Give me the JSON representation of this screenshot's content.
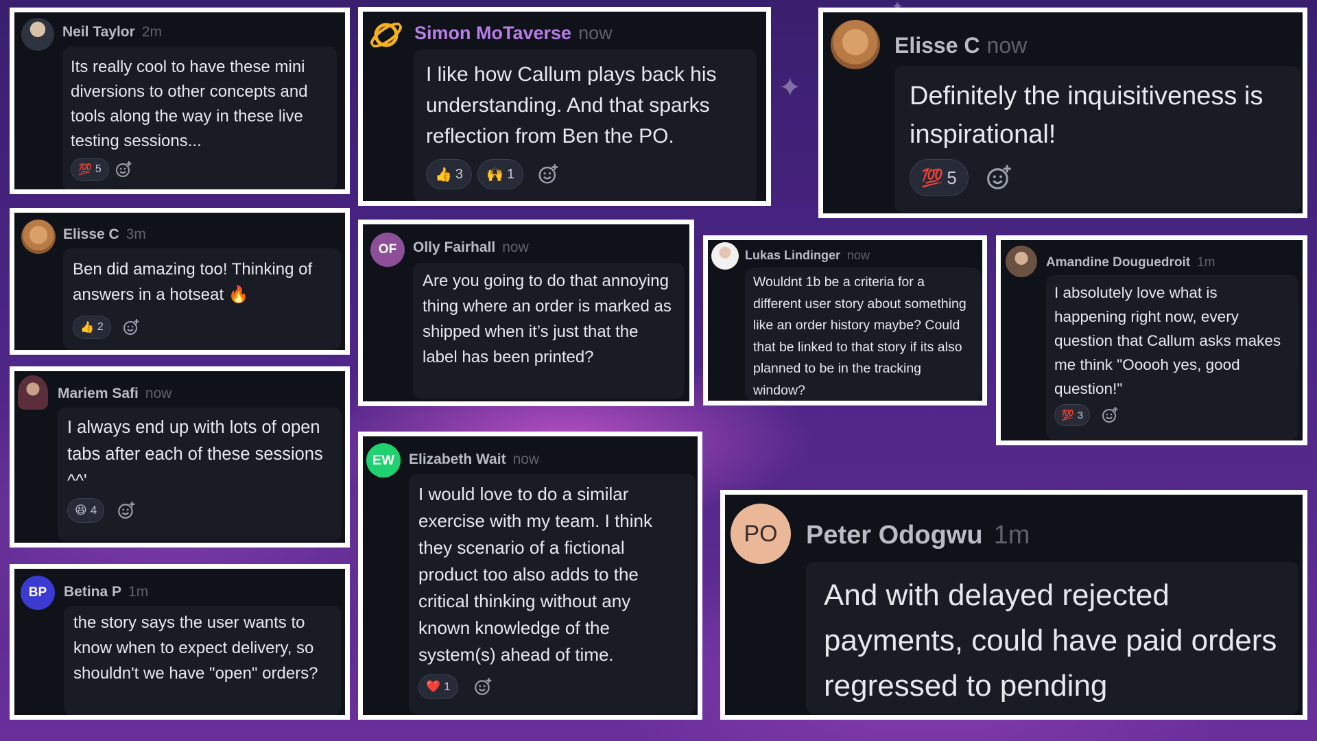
{
  "posts": [
    {
      "id": "neil",
      "name": "Neil Taylor",
      "time": "2m",
      "message": "Its really cool to have these mini diversions to other concepts and tools along the way in these live testing sessions...",
      "reactions": [
        {
          "emoji": "💯",
          "count": "5"
        }
      ]
    },
    {
      "id": "simon",
      "name": "Simon MoTaverse",
      "time": "now",
      "message": "I like how Callum plays back his understanding. And that sparks reflection from Ben the PO.",
      "reactions": [
        {
          "emoji": "👍",
          "count": "3"
        },
        {
          "emoji": "🙌",
          "count": "1"
        }
      ]
    },
    {
      "id": "elisse1",
      "name": "Elisse C",
      "time": "now",
      "message": "Definitely the inquisitiveness is inspirational!",
      "reactions": [
        {
          "emoji": "💯",
          "count": "5"
        }
      ]
    },
    {
      "id": "elisse2",
      "name": "Elisse C",
      "time": "3m",
      "message": "Ben did amazing too! Thinking of answers in a hotseat 🔥",
      "reactions": [
        {
          "emoji": "👍",
          "count": "2"
        }
      ]
    },
    {
      "id": "olly",
      "name": "Olly Fairhall",
      "time": "now",
      "initials": "OF",
      "message": "Are you going to do that annoying thing where an order is marked as shipped when it’s just that the label has been printed?",
      "reactions": []
    },
    {
      "id": "lukas",
      "name": "Lukas Lindinger",
      "time": "now",
      "message": "Wouldnt 1b be a criteria for a different user story about something like an order history maybe? Could that be linked to that story if its also planned to be in the tracking window?",
      "reactions": []
    },
    {
      "id": "amandine",
      "name": "Amandine Douguedroit",
      "time": "1m",
      "message": "I absolutely love what is happening right now, every question that Callum asks makes me think \"Ooooh yes, good question!\"",
      "reactions": [
        {
          "emoji": "💯",
          "count": "3"
        }
      ]
    },
    {
      "id": "mariem",
      "name": "Mariem Safi",
      "time": "now",
      "message": "I always end up with lots of open tabs after each of these sessions ^^'",
      "reactions": [
        {
          "emoji": "😆",
          "count": "4"
        }
      ]
    },
    {
      "id": "elizabeth",
      "name": "Elizabeth Wait",
      "time": "now",
      "initials": "EW",
      "message": "I would love to do a similar exercise with my team. I think they scenario of a fictional product too also adds to the critical thinking without any known knowledge of the system(s) ahead of time.",
      "reactions": [
        {
          "emoji": "❤️",
          "count": "1"
        }
      ]
    },
    {
      "id": "betina",
      "name": "Betina P",
      "time": "1m",
      "initials": "BP",
      "message": "the story says the user wants to know when to expect delivery, so shouldn't we have \"open\" orders?",
      "reactions": []
    },
    {
      "id": "peter",
      "name": "Peter Odogwu",
      "time": "1m",
      "initials": "PO",
      "message": "And with delayed rejected payments, could have paid orders regressed to pending",
      "reactions": []
    }
  ],
  "colors": {
    "card_bg": "#101219",
    "bubble_bg": "#191c25",
    "border": "#ffffff",
    "simon_name": "#b87ee8",
    "olly_avatar": "#8d4f9a",
    "elizabeth_avatar": "#1fd26f",
    "betina_avatar": "#3b3bd1",
    "peter_avatar": "#eab898"
  }
}
